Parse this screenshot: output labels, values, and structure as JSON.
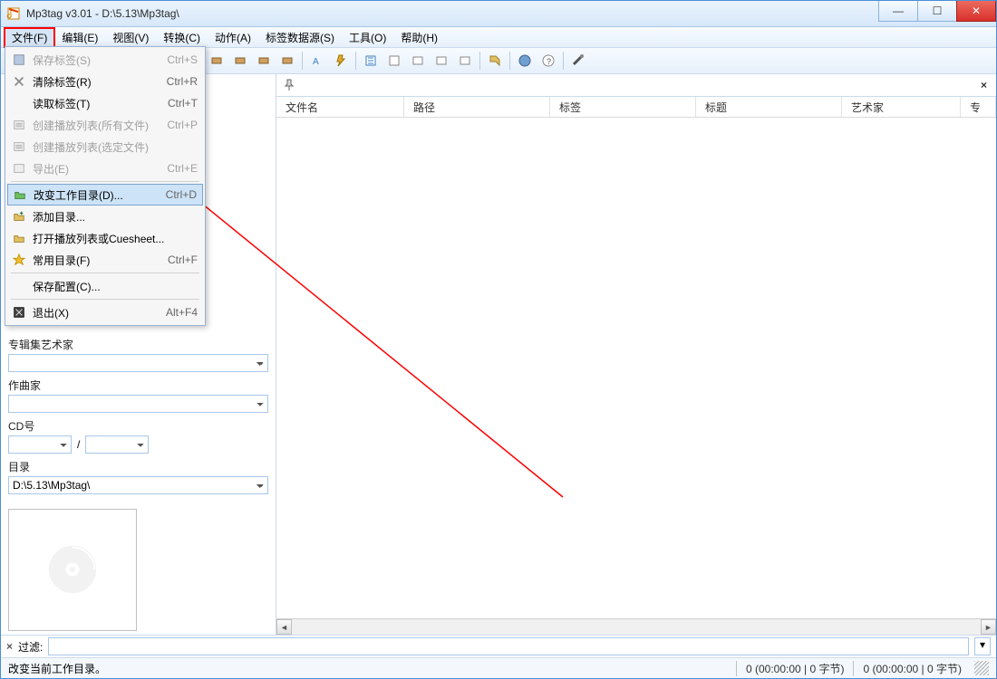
{
  "window": {
    "title": "Mp3tag v3.01  -  D:\\5.13\\Mp3tag\\"
  },
  "menubar": [
    "文件(F)",
    "编辑(E)",
    "视图(V)",
    "转换(C)",
    "动作(A)",
    "标签数据源(S)",
    "工具(O)",
    "帮助(H)"
  ],
  "file_menu": [
    {
      "icon": "save",
      "label": "保存标签(S)",
      "accel": "Ctrl+S",
      "disabled": true
    },
    {
      "icon": "x",
      "label": "清除标签(R)",
      "accel": "Ctrl+R"
    },
    {
      "icon": "",
      "label": "读取标签(T)",
      "accel": "Ctrl+T"
    },
    {
      "icon": "list",
      "label": "创建播放列表(所有文件)",
      "accel": "Ctrl+P",
      "disabled": true
    },
    {
      "icon": "list",
      "label": "创建播放列表(选定文件)",
      "accel": "",
      "disabled": true
    },
    {
      "icon": "export",
      "label": "导出(E)",
      "accel": "Ctrl+E",
      "disabled": true
    },
    {
      "sep": true
    },
    {
      "icon": "folder-green",
      "label": "改变工作目录(D)...",
      "accel": "Ctrl+D",
      "highlight": true
    },
    {
      "icon": "folder-add",
      "label": "添加目录...",
      "accel": ""
    },
    {
      "icon": "folder-open",
      "label": "打开播放列表或Cuesheet...",
      "accel": ""
    },
    {
      "icon": "star",
      "label": "常用目录(F)",
      "accel": "Ctrl+F"
    },
    {
      "sep": true
    },
    {
      "icon": "",
      "label": "保存配置(C)...",
      "accel": ""
    },
    {
      "sep": true
    },
    {
      "icon": "exit",
      "label": "退出(X)",
      "accel": "Alt+F4"
    }
  ],
  "sidebar": {
    "album_artist_label": "专辑集艺术家",
    "composer_label": "作曲家",
    "cd_label": "CD号",
    "cd_slash": "/",
    "dir_label": "目录",
    "dir_value": "D:\\5.13\\Mp3tag\\"
  },
  "list_headers": [
    "文件名",
    "路径",
    "标签",
    "标题",
    "艺术家",
    "专"
  ],
  "filter": {
    "label": "过滤:",
    "value": ""
  },
  "status": {
    "left": "改变当前工作目录。",
    "seg1": "0 (00:00:00 | 0 字节)",
    "seg2": "0 (00:00:00 | 0 字节)"
  }
}
